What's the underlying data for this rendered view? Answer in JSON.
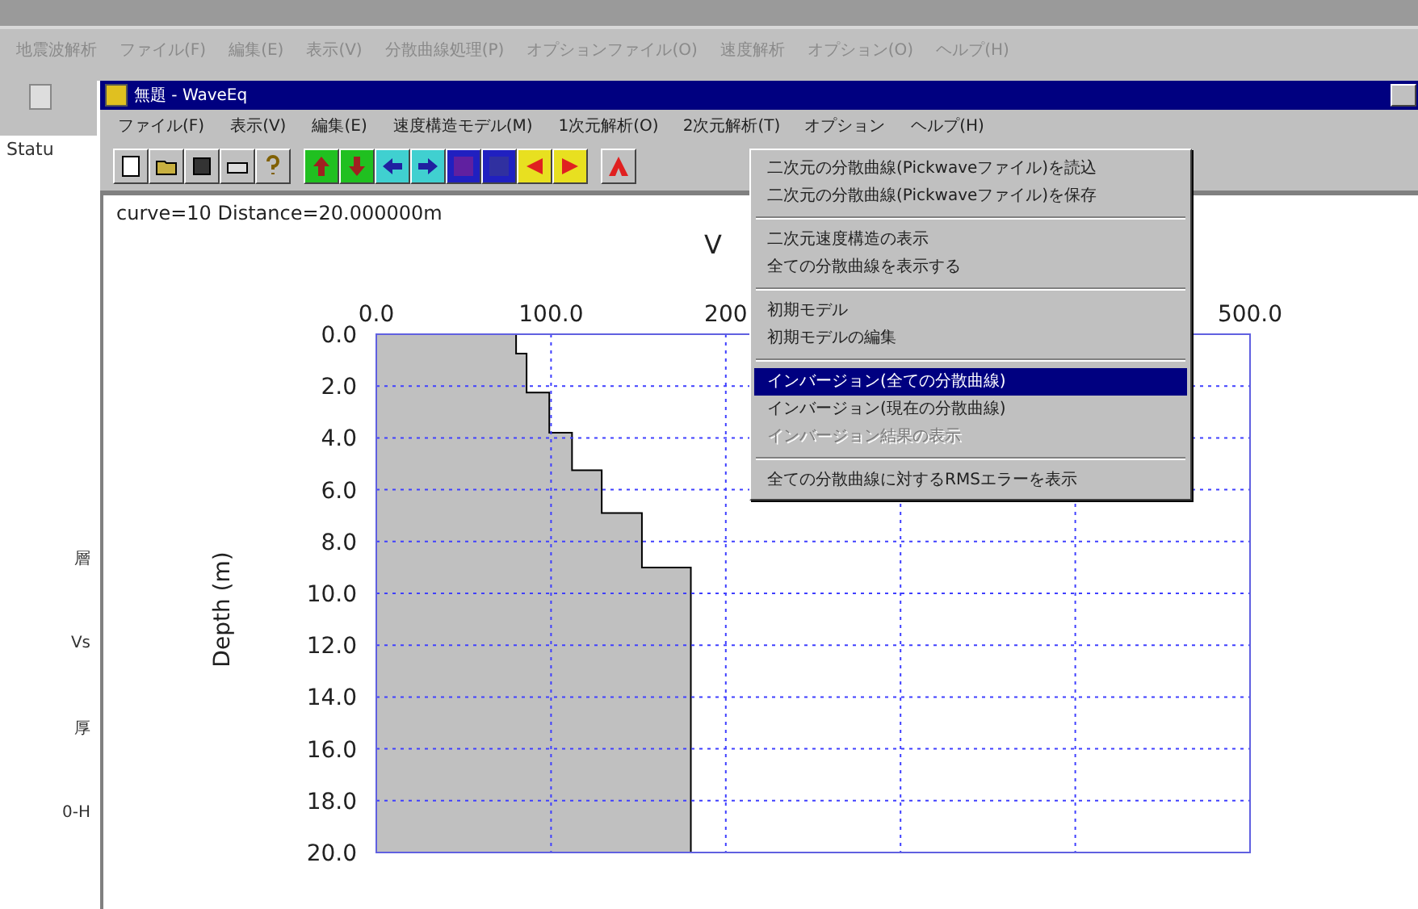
{
  "outer_window": {
    "menu": [
      "地震波解析",
      "ファイル(F)",
      "編集(E)",
      "表示(V)",
      "分散曲線処理(P)",
      "オプションファイル(O)",
      "速度解析",
      "オプション(O)",
      "ヘルプ(H)"
    ],
    "status_label": "Statu",
    "side_labels": [
      "層",
      "Vs",
      "厚",
      "0-H"
    ]
  },
  "window": {
    "title": "無題 - WaveEq",
    "menu": [
      {
        "label": "ファイル(F)",
        "selected": false
      },
      {
        "label": "表示(V)",
        "selected": false
      },
      {
        "label": "編集(E)",
        "selected": false
      },
      {
        "label": "速度構造モデル(M)",
        "selected": false
      },
      {
        "label": "1次元解析(O)",
        "selected": false
      },
      {
        "label": "2次元解析(T)",
        "selected": true
      },
      {
        "label": "オプション",
        "selected": false
      },
      {
        "label": "ヘルプ(H)",
        "selected": false
      }
    ]
  },
  "dropdown": [
    {
      "kind": "item",
      "label": "二次元の分散曲線(Pickwaveファイル)を読込",
      "selected": false,
      "disabled": false
    },
    {
      "kind": "item",
      "label": "二次元の分散曲線(Pickwaveファイル)を保存",
      "selected": false,
      "disabled": false
    },
    {
      "kind": "separator"
    },
    {
      "kind": "item",
      "label": "二次元速度構造の表示",
      "selected": false,
      "disabled": false
    },
    {
      "kind": "item",
      "label": "全ての分散曲線を表示する",
      "selected": false,
      "disabled": false
    },
    {
      "kind": "separator"
    },
    {
      "kind": "item",
      "label": "初期モデル",
      "selected": false,
      "disabled": false
    },
    {
      "kind": "item",
      "label": "初期モデルの編集",
      "selected": false,
      "disabled": false
    },
    {
      "kind": "separator"
    },
    {
      "kind": "item",
      "label": "インバージョン(全ての分散曲線)",
      "selected": true,
      "disabled": false
    },
    {
      "kind": "item",
      "label": "インバージョン(現在の分散曲線)",
      "selected": false,
      "disabled": false
    },
    {
      "kind": "item",
      "label": "インバージョン結果の表示",
      "selected": false,
      "disabled": true
    },
    {
      "kind": "separator"
    },
    {
      "kind": "item",
      "label": "全ての分散曲線に対するRMSエラーを表示",
      "selected": false,
      "disabled": false
    }
  ],
  "info": "curve=10 Distance=20.000000m",
  "chart_data": {
    "type": "area",
    "grid": true,
    "title": "V",
    "ylabel": "Depth (m)",
    "orientation": "horizontal",
    "x": [
      0,
      0.75,
      2.25,
      3.8,
      5.25,
      6.9,
      9.0,
      20
    ],
    "values": [
      80,
      86,
      99,
      112,
      129,
      152,
      180,
      180
    ],
    "xlim": [
      0,
      500
    ],
    "ylim": [
      20,
      0
    ],
    "xticks": [
      {
        "value": 0,
        "label": "0.0"
      },
      {
        "value": 100,
        "label": "100.0"
      },
      {
        "value": 200,
        "label": "200"
      },
      {
        "value": 500,
        "label": "500.0"
      }
    ],
    "yticks": [
      {
        "value": 0,
        "label": "0.0"
      },
      {
        "value": 2,
        "label": "2.0"
      },
      {
        "value": 4,
        "label": "4.0"
      },
      {
        "value": 6,
        "label": "6.0"
      },
      {
        "value": 8,
        "label": "8.0"
      },
      {
        "value": 10,
        "label": "10.0"
      },
      {
        "value": 12,
        "label": "12.0"
      },
      {
        "value": 14,
        "label": "14.0"
      },
      {
        "value": 16,
        "label": "16.0"
      },
      {
        "value": 18,
        "label": "18.0"
      },
      {
        "value": 20,
        "label": "20.0"
      }
    ]
  }
}
